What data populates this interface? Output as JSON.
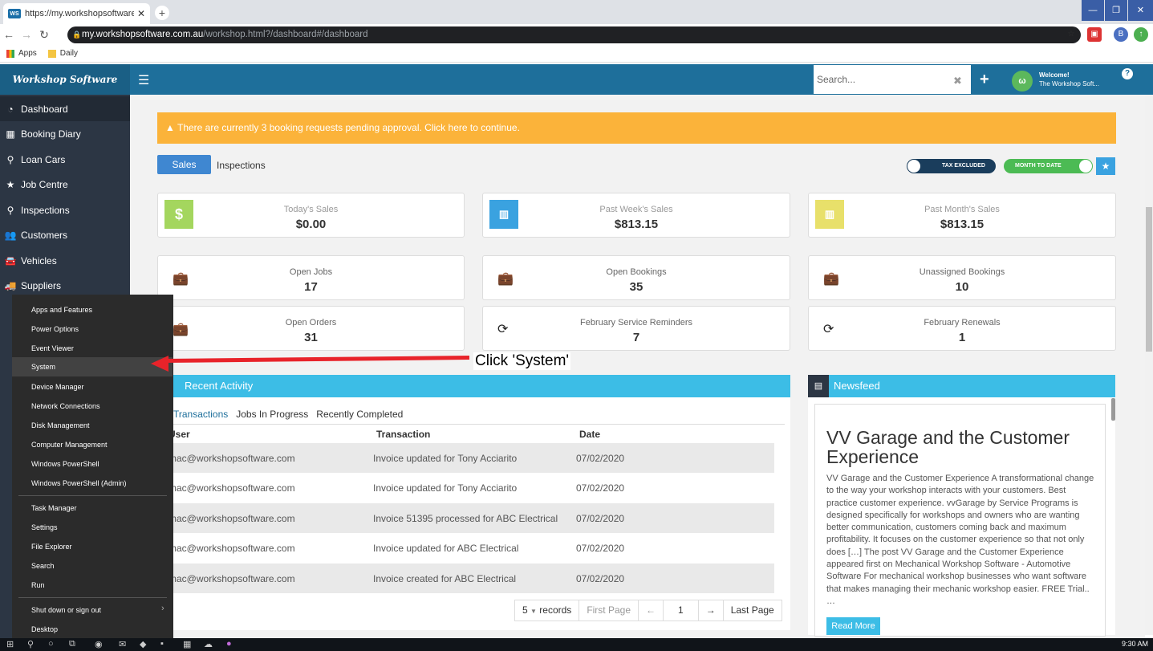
{
  "browser": {
    "tab_title": "https://my.workshopsoftware.co",
    "tab_favicon": "WS",
    "url_host": "my.workshopsoftware.com.au",
    "url_path": "/workshop.html?/dashboard#/dashboard",
    "bookmarks": [
      "Apps",
      "Daily"
    ],
    "profile_initial": "B"
  },
  "header": {
    "brand": "Workshop Software",
    "search_placeholder": "Search...",
    "welcome_title": "Welcome!",
    "welcome_name": "The Workshop Soft..."
  },
  "sidebar": {
    "items": [
      {
        "label": "Dashboard",
        "icon": "dashboard-icon"
      },
      {
        "label": "Booking Diary",
        "icon": "calendar-icon"
      },
      {
        "label": "Loan Cars",
        "icon": "search-icon"
      },
      {
        "label": "Job Centre",
        "icon": "star-icon"
      },
      {
        "label": "Inspections",
        "icon": "search-icon"
      },
      {
        "label": "Customers",
        "icon": "users-icon"
      },
      {
        "label": "Vehicles",
        "icon": "car-icon"
      },
      {
        "label": "Suppliers",
        "icon": "truck-icon"
      }
    ]
  },
  "alert": {
    "text": "There are currently 3 booking requests pending approval. Click here to continue."
  },
  "tabs": {
    "sales": "Sales",
    "inspections": "Inspections"
  },
  "toggles": {
    "tax": "TAX EXCLUDED",
    "period": "MONTH TO DATE"
  },
  "stats": [
    {
      "label": "Today's Sales",
      "value": "$0.00"
    },
    {
      "label": "Past Week's Sales",
      "value": "$813.15"
    },
    {
      "label": "Past Month's Sales",
      "value": "$813.15"
    },
    {
      "label": "Open Jobs",
      "value": "17"
    },
    {
      "label": "Open Bookings",
      "value": "35"
    },
    {
      "label": "Unassigned Bookings",
      "value": "10"
    },
    {
      "label": "Open Orders",
      "value": "31"
    },
    {
      "label": "February Service Reminders",
      "value": "7"
    },
    {
      "label": "February Renewals",
      "value": "1"
    }
  ],
  "recent": {
    "title": "Recent Activity",
    "tabs": [
      "Transactions",
      "Jobs In Progress",
      "Recently Completed"
    ],
    "columns": [
      "User",
      "Transaction",
      "Date"
    ],
    "rows": [
      {
        "user": "mac@workshopsoftware.com",
        "tx": "Invoice updated for Tony Acciarito",
        "date": "07/02/2020"
      },
      {
        "user": "mac@workshopsoftware.com",
        "tx": "Invoice updated for Tony Acciarito",
        "date": "07/02/2020"
      },
      {
        "user": "mac@workshopsoftware.com",
        "tx": "Invoice 51395 processed for ABC Electrical",
        "date": "07/02/2020"
      },
      {
        "user": "mac@workshopsoftware.com",
        "tx": "Invoice updated for ABC Electrical",
        "date": "07/02/2020"
      },
      {
        "user": "mac@workshopsoftware.com",
        "tx": "Invoice created for ABC Electrical",
        "date": "07/02/2020"
      }
    ],
    "pager": {
      "per_page": "5",
      "records": "records",
      "first": "First Page",
      "prev": "←",
      "page": "1",
      "next": "→",
      "last": "Last Page"
    }
  },
  "newsfeed": {
    "title": "Newsfeed",
    "article_title": "VV Garage and the Customer Experience",
    "article_text": "VV Garage and the Customer Experience A transformational change to the way your workshop interacts with your customers. Best practice customer experience. vvGarage by Service Programs is designed specifically for workshops and owners who are wanting better communication, customers coming back and maximum profitability. It focuses on the customer experience so that not only does […] The post VV Garage and the Customer Experience appeared first on Mechanical Workshop Software - Automotive Software For mechanical workshop businesses who want software that makes managing their mechanic workshop easier. FREE Trial.. …",
    "read_more": "Read More"
  },
  "winx_menu": {
    "items": [
      "Apps and Features",
      "Power Options",
      "Event Viewer",
      "System",
      "Device Manager",
      "Network Connections",
      "Disk Management",
      "Computer Management",
      "Windows PowerShell",
      "Windows PowerShell (Admin)",
      "Task Manager",
      "Settings",
      "File Explorer",
      "Search",
      "Run",
      "Shut down or sign out",
      "Desktop"
    ],
    "selected": "System"
  },
  "annotation": {
    "text": "Click 'System'"
  },
  "taskbar": {
    "clock": "9:30 AM"
  },
  "colors": {
    "header": "#1e6f9b",
    "sidebar": "#2c3644",
    "alert": "#fbb33a",
    "accent": "#3cbde6",
    "arrow": "#e8232a"
  }
}
